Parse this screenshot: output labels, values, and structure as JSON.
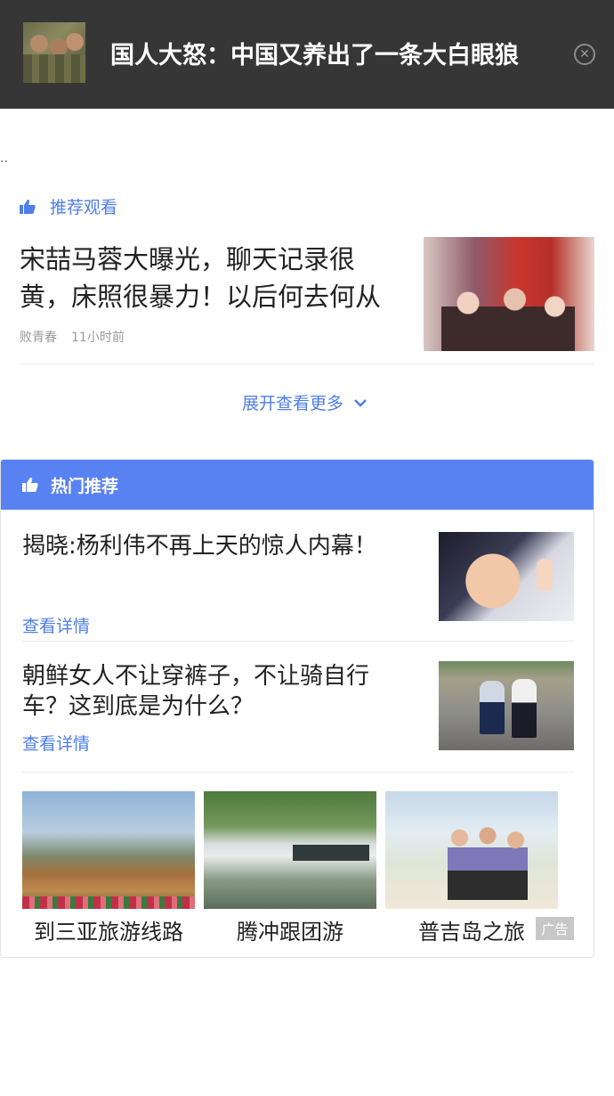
{
  "top_mark": "---",
  "header": {
    "title": "国人大怒：中国又养出了一条大白眼狼",
    "close_glyph": "✕"
  },
  "dots": "..",
  "recommended": {
    "label": "推荐观看",
    "article": {
      "title": "宋喆马蓉大曝光，聊天记录很黄，床照很暴力！以后何去何从",
      "source": "败青春",
      "time": "11小时前"
    },
    "expand_label": "展开查看更多"
  },
  "hot": {
    "label": "热门推荐",
    "items": [
      {
        "title": "揭晓:杨利伟不再上天的惊人内幕！",
        "link": "查看详情"
      },
      {
        "title": "朝鲜女人不让穿裤子，不让骑自行车？这到底是为什么？",
        "link": "查看详情"
      }
    ],
    "ads": [
      {
        "caption": "到三亚旅游线路"
      },
      {
        "caption": "腾冲跟团游"
      },
      {
        "caption": "普吉岛之旅"
      }
    ],
    "ad_badge": "广告"
  },
  "colors": {
    "accent": "#4f7ee8",
    "card_header": "#5882f2",
    "header_bg": "#363636"
  }
}
